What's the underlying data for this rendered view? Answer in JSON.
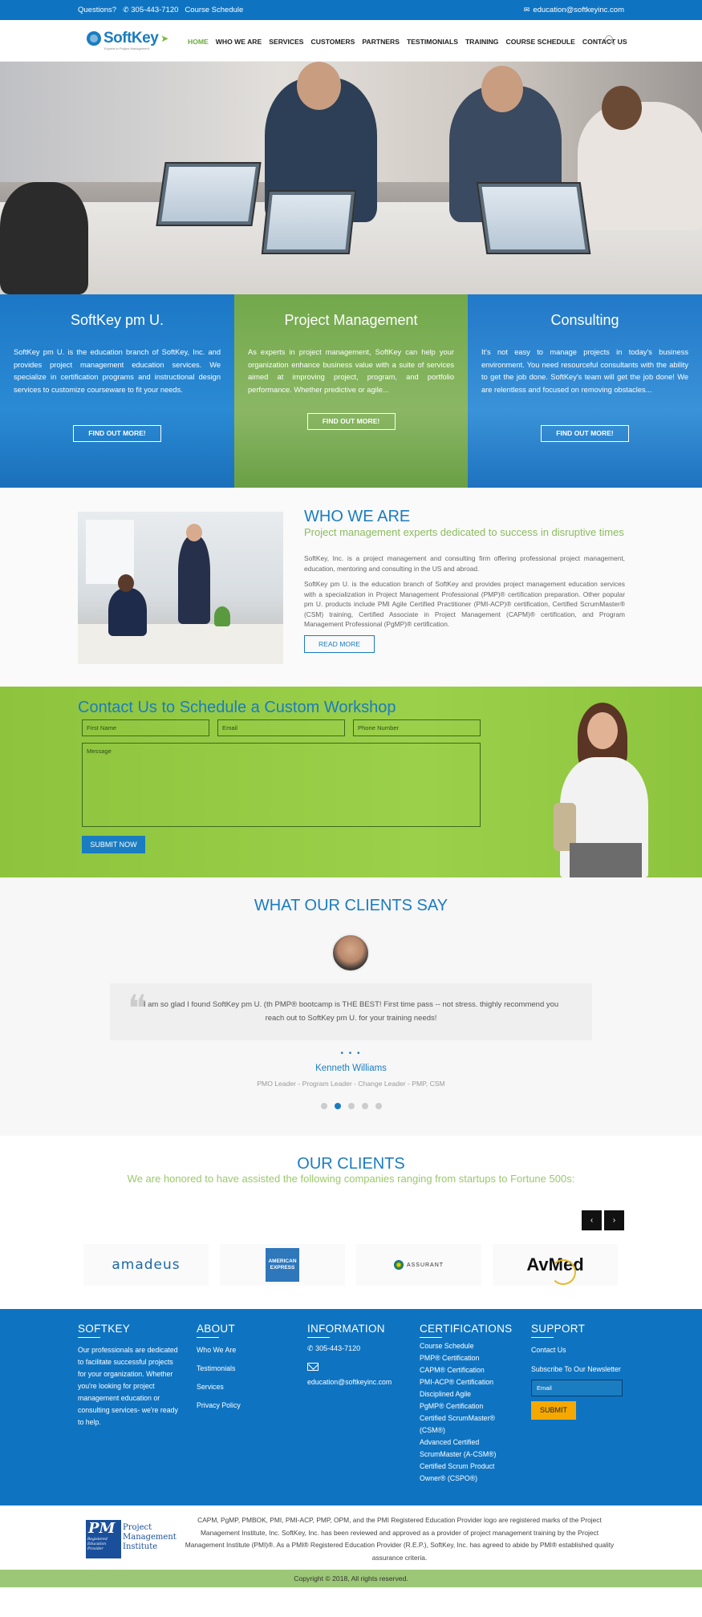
{
  "topbar": {
    "questions": "Questions?",
    "phone": "305-443-7120",
    "course_schedule": "Course Schedule",
    "email": "education@softkeyinc.com"
  },
  "header": {
    "logo_text": "SoftKey",
    "logo_subtitle": "Experts in Project Management",
    "nav": [
      "HOME",
      "WHO WE ARE",
      "SERVICES",
      "CUSTOMERS",
      "PARTNERS",
      "TESTIMONIALS",
      "TRAINING",
      "COURSE SCHEDULE",
      "CONTACT US"
    ],
    "active_nav": "HOME"
  },
  "columns": [
    {
      "title": "SoftKey pm U.",
      "text": "SoftKey pm U. is the education branch of SoftKey, Inc. and provides project management education services. We specialize in certification programs and instructional design services to customize courseware to fit your needs.",
      "button": "FIND OUT MORE!"
    },
    {
      "title": "Project Management",
      "text": "As experts in project management, SoftKey can help your organization enhance business value with a suite of services aimed at improving project, program, and portfolio performance. Whether predictive or agile...",
      "button": "FIND OUT MORE!"
    },
    {
      "title": "Consulting",
      "text": "It's not easy to manage projects in today's business environment. You need resourceful consultants with the ability to get the job done. SoftKey's team will get the job done! We are relentless and focused on removing obstacles...",
      "button": "FIND OUT MORE!"
    }
  ],
  "who": {
    "title": "WHO WE ARE",
    "subtitle": "Project management experts dedicated to success in disruptive times",
    "para1": "SoftKey, Inc. is a project management and consulting firm offering professional project management, education, mentoring and consulting in the US and abroad.",
    "para2": "SoftKey pm U. is the education branch of SoftKey and provides project management education services with a specialization in Project Management Professional (PMP)® certification preparation. Other popular pm U. products include PMI Agile Certified Practitioner (PMI-ACP)® certification, Certified ScrumMaster® (CSM) training, Certified Associate in Project Management (CAPM)® certification, and Program Management Professional (PgMP)® certification.",
    "button": "READ MORE"
  },
  "contact": {
    "title": "Contact Us to Schedule a Custom Workshop",
    "first_name": "First Name",
    "email": "Email",
    "phone": "Phone Number",
    "message": "Message",
    "submit": "SUBMIT NOW"
  },
  "testimonials": {
    "title": "WHAT OUR CLIENTS SAY",
    "quote": "I am so glad I found SoftKey pm U. (th PMP® bootcamp is THE BEST! First time pass -- not stress. thighly recommend you reach out to SoftKey pm U. for your training needs!",
    "dots": "• • •",
    "name": "Kenneth Williams",
    "role": "PMO Leader - Program Leader - Change Leader - PMP, CSM",
    "pages": 5,
    "active_page": 2
  },
  "our_clients": {
    "title": "OUR CLIENTS",
    "subtitle": "We are honored to have assisted the following companies ranging from startups to Fortune 500s:",
    "prev": "‹",
    "next": "›",
    "logos": [
      "amadeus",
      "AMERICAN EXPRESS",
      "ASSURANT",
      "AvMed"
    ]
  },
  "footer": {
    "softkey": {
      "title": "SOFTKEY",
      "text": "Our professionals are dedicated to facilitate successful projects for your organization. Whether you're looking for project management education or consulting services- we're ready to help."
    },
    "about": {
      "title": "ABOUT",
      "links": [
        "Who We Are",
        "Testimonials",
        "Services",
        "Privacy Policy"
      ]
    },
    "information": {
      "title": "INFORMATION",
      "phone": "305-443-7120",
      "email": "education@softkeyinc.com"
    },
    "certifications": {
      "title": "CERTIFICATIONS",
      "links": [
        "Course Schedule",
        "PMP® Certification",
        "CAPM® Certification",
        "PMI-ACP® Certification",
        "Disciplined Agile",
        "PgMP® Certification",
        "Certified ScrumMaster® (CSM®)",
        "Advanced Certified ScrumMaster (A-CSM®)",
        "Certified Scrum Product Owner® (CSPO®)"
      ]
    },
    "support": {
      "title": "SUPPORT",
      "contact": "Contact Us",
      "newsletter": "Subscribe To Our Newsletter",
      "email_placeholder": "Email",
      "submit": "SUBMIT"
    }
  },
  "notice": {
    "pmi_logo_line1": "Project",
    "pmi_logo_line2": "Management",
    "pmi_logo_line3": "Institute",
    "pmi_mark": "PM",
    "pmi_small": "Registered Education Provider",
    "text": "CAPM, PgMP, PMBOK, PMI, PMI-ACP, PMP, OPM, and the PMI Registered Education Provider logo are registered marks of the Project Management Institute, Inc. SoftKey, Inc. has been reviewed and approved as a provider of project management training by the Project Management Institute (PMI)®. As a PMI® Registered Education Provider (R.E.P.), SoftKey, Inc. has agreed to abide by PMI® established quality assurance criteria."
  },
  "copyright": "Copyright © 2018, All rights reserved.",
  "colors": {
    "primary_blue": "#0e74c2",
    "accent_green": "#8ec43d",
    "submit_orange": "#f5a900"
  }
}
